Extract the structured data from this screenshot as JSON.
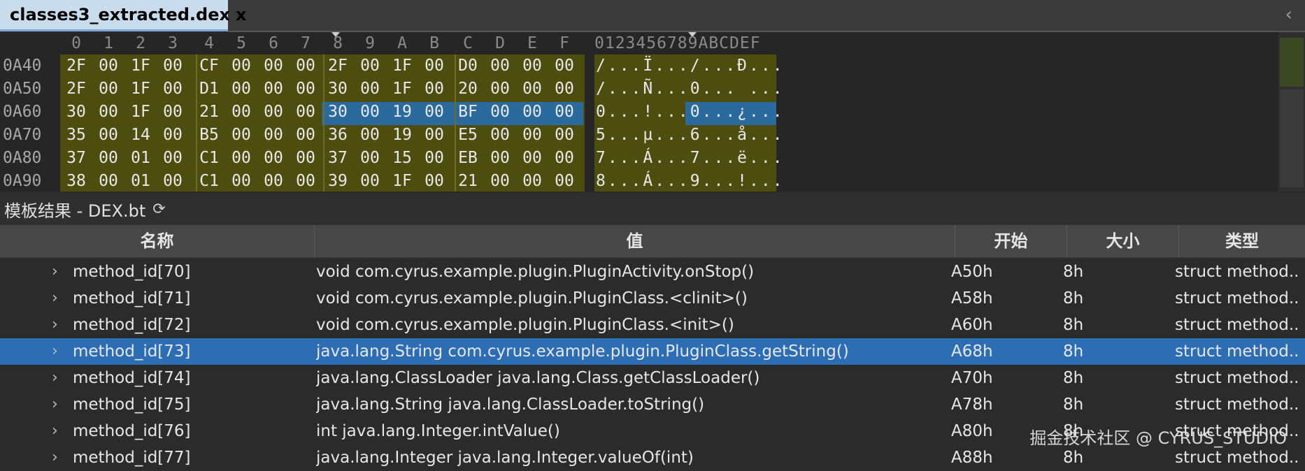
{
  "tab": {
    "title": "classes3_extracted.dex",
    "close": "x",
    "scroll_glyph": "‹"
  },
  "hex": {
    "column_headers": [
      "0",
      "1",
      "2",
      "3",
      "4",
      "5",
      "6",
      "7",
      "8",
      "9",
      "A",
      "B",
      "C",
      "D",
      "E",
      "F"
    ],
    "ascii_header": "0123456789ABCDEF",
    "rows": [
      {
        "addr": "0A40",
        "bytes": [
          "2F",
          "00",
          "1F",
          "00",
          "CF",
          "00",
          "00",
          "00",
          "2F",
          "00",
          "1F",
          "00",
          "D0",
          "00",
          "00",
          "00"
        ],
        "ascii": "/...Ï.../...Ð..."
      },
      {
        "addr": "0A50",
        "bytes": [
          "2F",
          "00",
          "1F",
          "00",
          "D1",
          "00",
          "00",
          "00",
          "30",
          "00",
          "1F",
          "00",
          "20",
          "00",
          "00",
          "00"
        ],
        "ascii": "/...Ñ...0... ..."
      },
      {
        "addr": "0A60",
        "bytes": [
          "30",
          "00",
          "1F",
          "00",
          "21",
          "00",
          "00",
          "00",
          "30",
          "00",
          "19",
          "00",
          "BF",
          "00",
          "00",
          "00"
        ],
        "ascii": "0...!...0...¿..."
      },
      {
        "addr": "0A70",
        "bytes": [
          "35",
          "00",
          "14",
          "00",
          "B5",
          "00",
          "00",
          "00",
          "36",
          "00",
          "19",
          "00",
          "E5",
          "00",
          "00",
          "00"
        ],
        "ascii": "5...µ...6...å..."
      },
      {
        "addr": "0A80",
        "bytes": [
          "37",
          "00",
          "01",
          "00",
          "C1",
          "00",
          "00",
          "00",
          "37",
          "00",
          "15",
          "00",
          "EB",
          "00",
          "00",
          "00"
        ],
        "ascii": "7...Á...7...ë..."
      },
      {
        "addr": "0A90",
        "bytes": [
          "38",
          "00",
          "01",
          "00",
          "C1",
          "00",
          "00",
          "00",
          "39",
          "00",
          "1F",
          "00",
          "21",
          "00",
          "00",
          "00"
        ],
        "ascii": "8...Á...9...!..."
      }
    ]
  },
  "template": {
    "title": "模板结果 - DEX.bt",
    "refresh_glyph": "⟳",
    "columns": [
      "名称",
      "值",
      "开始",
      "大小",
      "类型"
    ],
    "rows": [
      {
        "name": "method_id[70]",
        "value": "void com.cyrus.example.plugin.PluginActivity.onStop()",
        "start": "A50h",
        "size": "8h",
        "type": "struct method..."
      },
      {
        "name": "method_id[71]",
        "value": "void com.cyrus.example.plugin.PluginClass.<clinit>()",
        "start": "A58h",
        "size": "8h",
        "type": "struct method..."
      },
      {
        "name": "method_id[72]",
        "value": "void com.cyrus.example.plugin.PluginClass.<init>()",
        "start": "A60h",
        "size": "8h",
        "type": "struct method..."
      },
      {
        "name": "method_id[73]",
        "value": "java.lang.String com.cyrus.example.plugin.PluginClass.getString()",
        "start": "A68h",
        "size": "8h",
        "type": "struct method..."
      },
      {
        "name": "method_id[74]",
        "value": "java.lang.ClassLoader java.lang.Class.getClassLoader()",
        "start": "A70h",
        "size": "8h",
        "type": "struct method..."
      },
      {
        "name": "method_id[75]",
        "value": "java.lang.String java.lang.ClassLoader.toString()",
        "start": "A78h",
        "size": "8h",
        "type": "struct method..."
      },
      {
        "name": "method_id[76]",
        "value": "int java.lang.Integer.intValue()",
        "start": "A80h",
        "size": "8h",
        "type": "struct method..."
      },
      {
        "name": "method_id[77]",
        "value": "java.lang.Integer java.lang.Integer.valueOf(int)",
        "start": "A88h",
        "size": "8h",
        "type": "struct method..."
      }
    ],
    "selected_row": "method_id[73]"
  },
  "watermark": "掘金技术社区 @ CYRUS_STUDIO",
  "colors": {
    "selection": "#2d6db3",
    "hex_highlight": "#4d4d10",
    "tab_active": "#c8dcec"
  }
}
